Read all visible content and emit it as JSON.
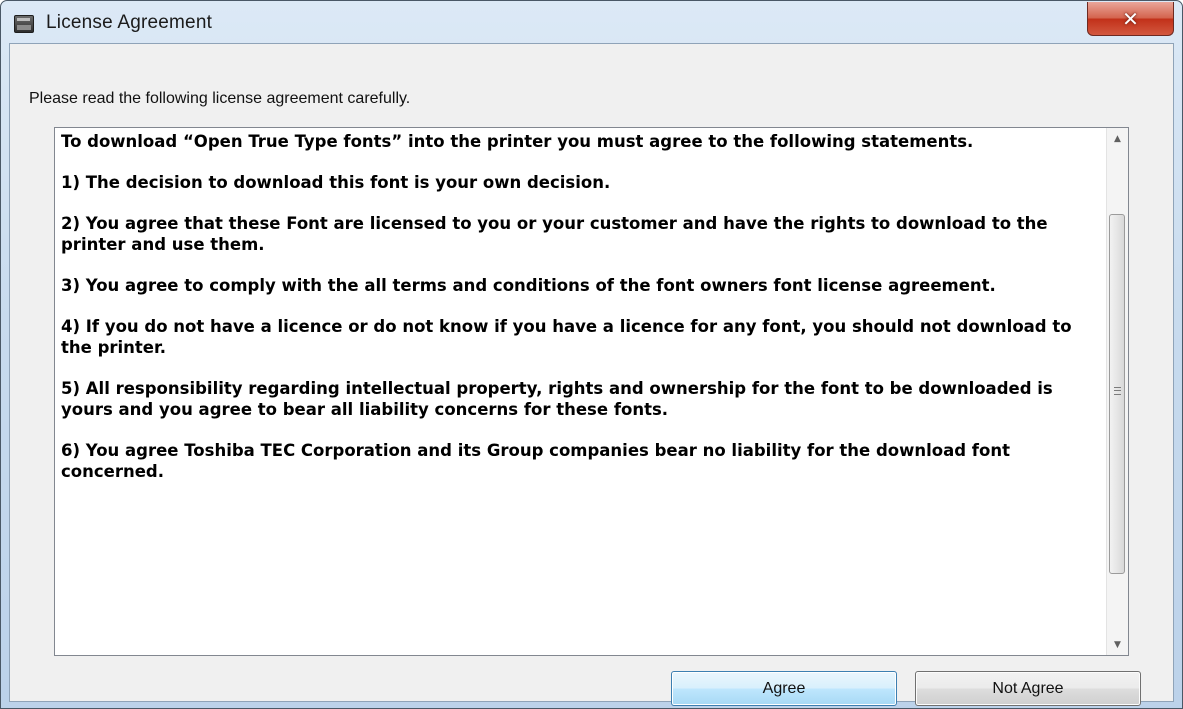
{
  "window": {
    "title": "License Agreement",
    "close_glyph": "✕",
    "icon": "app-window-icon"
  },
  "instruction": "Please read the following license agreement carefully.",
  "license": {
    "paragraphs": [
      "To download “Open True Type fonts” into the printer you must agree to the following statements.",
      "1) The decision to download this font is your own decision.",
      "2) You agree that these Font are licensed to you or your customer and have the rights to download to the printer and use them.",
      "3) You agree to comply with the all terms and conditions of the font owners font license agreement.",
      "4) If you do not have a licence or do not know if you have a licence for any font, you should not download to the printer.",
      "5) All responsibility regarding intellectual property, rights and ownership for the font to be downloaded is yours and you agree to bear all liability concerns for these fonts.",
      "6) You agree Toshiba TEC Corporation and its Group companies bear no liability for the download font concerned."
    ]
  },
  "scrollbar": {
    "up_glyph": "▲",
    "down_glyph": "▼"
  },
  "buttons": {
    "agree": "Agree",
    "not_agree": "Not Agree"
  },
  "colors": {
    "close_button": "#c2311a",
    "default_button_border": "#3c7fb1",
    "dialog_background": "#f0f0f0"
  }
}
